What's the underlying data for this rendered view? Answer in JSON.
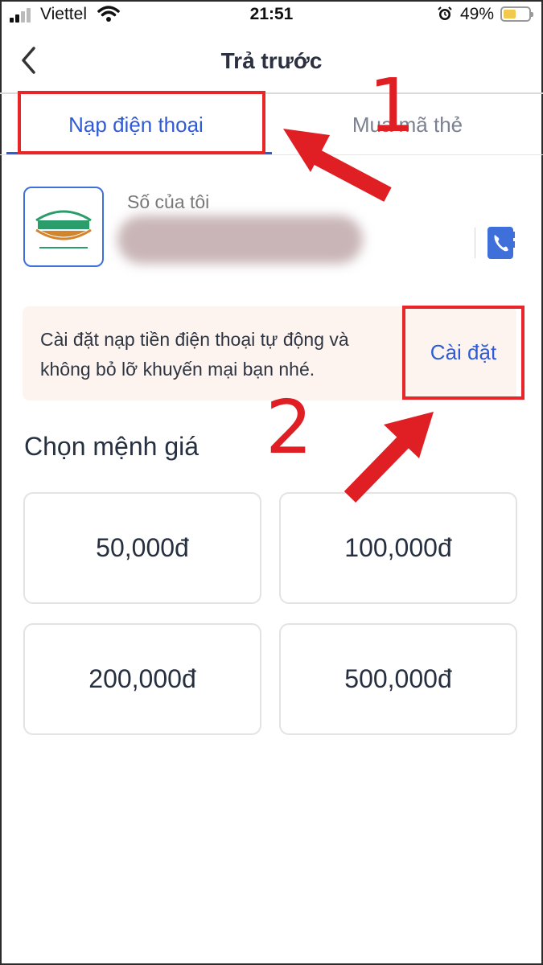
{
  "status_bar": {
    "carrier": "Viettel",
    "time": "21:51",
    "battery_percent": "49%",
    "battery_level": 0.49,
    "icons": [
      "signal-icon",
      "wifi-icon",
      "alarm-icon",
      "battery-icon"
    ]
  },
  "header": {
    "title": "Trả trước",
    "back_icon": "chevron-left-icon"
  },
  "tabs": [
    {
      "label": "Nạp điện thoại",
      "active": true
    },
    {
      "label": "Mua mã thẻ",
      "active": false
    }
  ],
  "phone": {
    "operator_logo": "viettel-logo",
    "label": "Số của tôi",
    "number_hidden": true,
    "contact_icon": "phone-book-icon"
  },
  "banner": {
    "text": "Cài đặt nạp tiền điện thoại tự động và không bỏ lỡ khuyến mại bạn nhé.",
    "button_label": "Cài đặt"
  },
  "denominations": {
    "title": "Chọn mệnh giá",
    "options": [
      "50,000đ",
      "100,000đ",
      "200,000đ",
      "500,000đ"
    ]
  },
  "annotations": {
    "step1": "1",
    "step2": "2",
    "color": "#e01f25"
  },
  "colors": {
    "accent": "#2f5bd7",
    "banner_bg": "#fdf4ef"
  }
}
